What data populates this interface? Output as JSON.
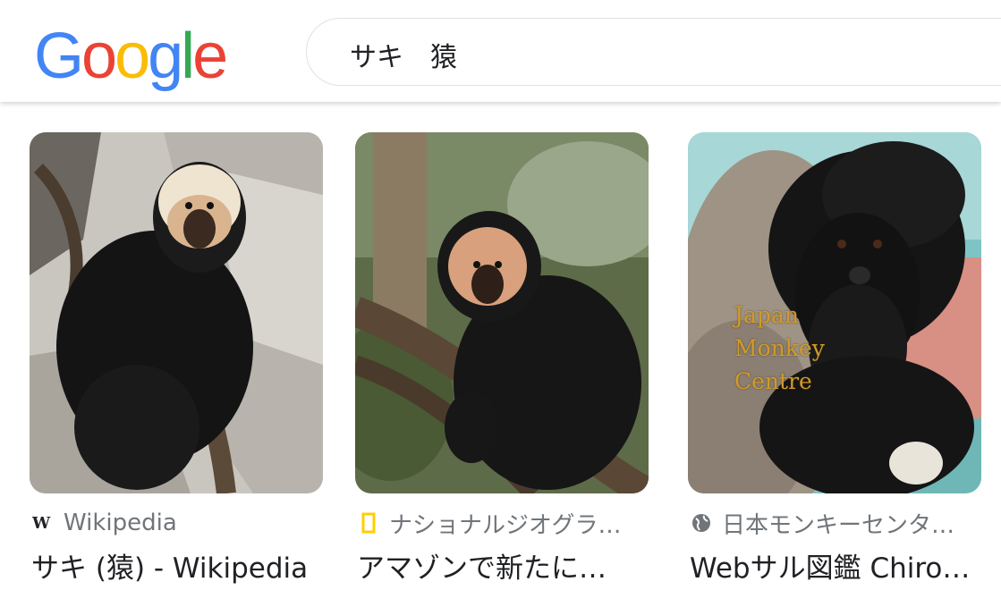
{
  "header": {
    "logo_letters": [
      "G",
      "o",
      "o",
      "g",
      "l",
      "e"
    ],
    "logo_colors": [
      "#4285F4",
      "#EA4335",
      "#FBBC05",
      "#4285F4",
      "#34A853",
      "#EA4335"
    ],
    "search_query": "サキ　猿"
  },
  "results": [
    {
      "source": "Wikipedia",
      "source_icon": "wikipedia-icon",
      "title": "サキ (猿) - Wikipedia"
    },
    {
      "source": "ナショナルジオグラ…",
      "source_icon": "natgeo-icon",
      "title": "アマゾンで新たに…"
    },
    {
      "source": "日本モンキーセンタ…",
      "source_icon": "globe-icon",
      "title": "Webサル図鑑 Chiro…",
      "watermark": [
        "Japan",
        "Monkey",
        "Centre"
      ]
    }
  ]
}
